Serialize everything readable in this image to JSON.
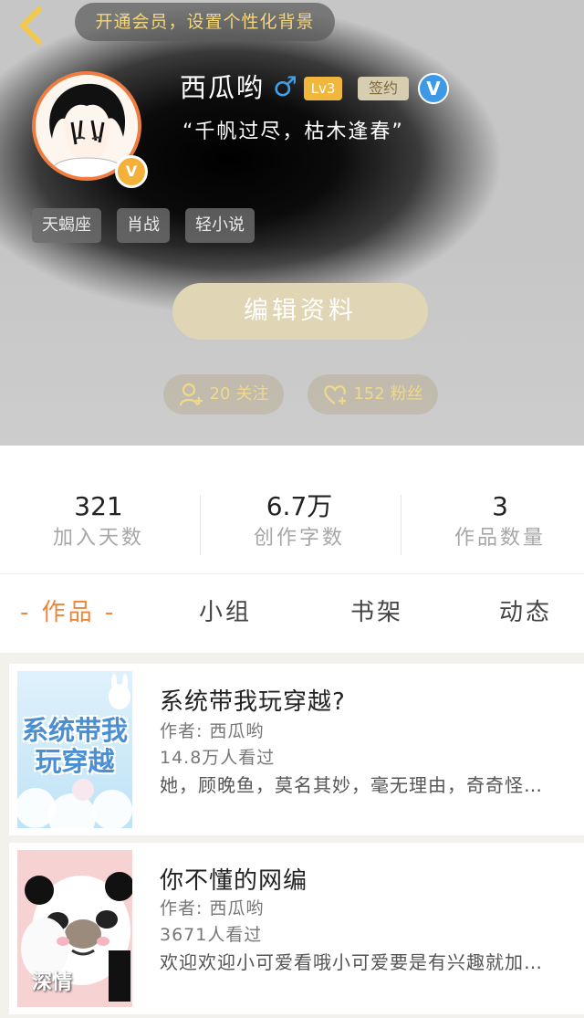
{
  "header": {
    "banner": "开通会员，设置个性化背景",
    "avatar_badge": "V",
    "name": "西瓜哟",
    "gender_symbol": "♂",
    "level": "Lv3",
    "signed_badge": "签约",
    "verified_symbol": "V",
    "quote": "“千帆过尽，枯木逢春”",
    "tags": [
      "天蝎座",
      "肖战",
      "轻小说"
    ],
    "edit_button": "编辑资料",
    "follow": {
      "count": "20",
      "label": "关注"
    },
    "fans": {
      "count": "152",
      "label": "粉丝"
    }
  },
  "stats": [
    {
      "value": "321",
      "label": "加入天数"
    },
    {
      "value": "6.7万",
      "label": "创作字数"
    },
    {
      "value": "3",
      "label": "作品数量"
    }
  ],
  "tabs": [
    "- 作品 -",
    "小组",
    "书架",
    "动态"
  ],
  "works": [
    {
      "title": "系统带我玩穿越?",
      "author": "作者: 西瓜哟",
      "views": "14.8万人看过",
      "desc": "她，顾晚鱼，莫名其妙，毫无理由，奇奇怪…",
      "cover_text": "系统带我玩穿越"
    },
    {
      "title": "你不懂的网编",
      "author": "作者: 西瓜哟",
      "views": "3671人看过",
      "desc": "欢迎欢迎小可爱看哦小可爱要是有兴趣就加…",
      "cover_text": "深情"
    }
  ],
  "colors": {
    "accent": "#f0853a",
    "gold": "#f0d88b",
    "level": "#f1b73c",
    "verify": "#3d98e6"
  }
}
